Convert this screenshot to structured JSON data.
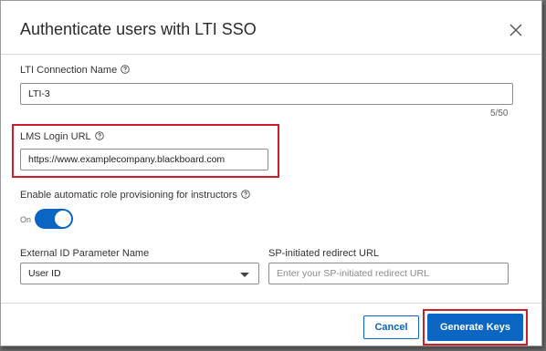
{
  "dialog": {
    "title": "Authenticate users with LTI SSO",
    "close_icon": "close-icon"
  },
  "connection_name": {
    "label": "LTI Connection Name",
    "value": "LTI-3",
    "counter": "5/50",
    "help_icon": "help-circle-icon"
  },
  "lms_login_url": {
    "label": "LMS Login URL",
    "value": "https://www.examplecompany.blackboard.com",
    "help_icon": "help-circle-icon"
  },
  "role_provisioning": {
    "label": "Enable automatic role provisioning for instructors",
    "toggle_state": "On",
    "enabled": true,
    "help_icon": "help-circle-icon"
  },
  "external_id": {
    "label": "External ID Parameter Name",
    "selected": "User ID",
    "caret_icon": "caret-down-icon"
  },
  "sp_redirect": {
    "label": "SP-initiated redirect URL",
    "placeholder": "Enter your SP-initiated redirect URL",
    "value": ""
  },
  "footer": {
    "cancel_label": "Cancel",
    "generate_label": "Generate Keys"
  },
  "colors": {
    "accent": "#0a66c2",
    "highlight": "#cc1f2d"
  }
}
